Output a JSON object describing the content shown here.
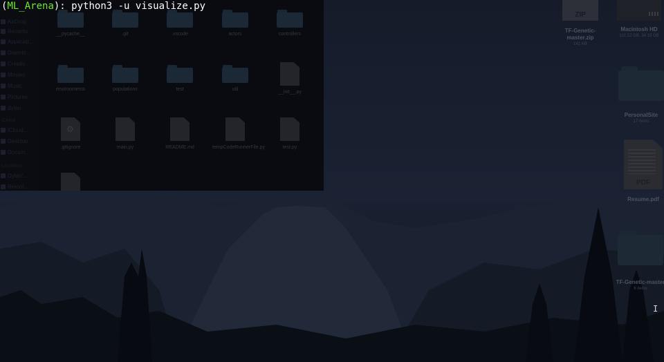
{
  "terminal": {
    "prompt_open": "(",
    "env_name": "ML_Arena",
    "prompt_close": "): ",
    "command": "python3 -u visualize.py"
  },
  "finder": {
    "sidebar": {
      "sections": [
        {
          "heading": "",
          "items": [
            "AirDrop",
            "Recents",
            "Applicati...",
            "Downlo...",
            "Creativ...",
            "Movies",
            "Music",
            "Pictures",
            "dylan"
          ]
        },
        {
          "heading": "iCloud",
          "items": [
            "iCloud...",
            "Desktop",
            "Docum..."
          ]
        },
        {
          "heading": "Locations",
          "items": [
            "Dylan'...",
            "Remot..."
          ]
        }
      ]
    },
    "items": [
      {
        "label": "__pycache__",
        "kind": "folder"
      },
      {
        "label": ".git",
        "kind": "folder"
      },
      {
        "label": ".vscode",
        "kind": "folder"
      },
      {
        "label": "actors",
        "kind": "folder"
      },
      {
        "label": "controllers",
        "kind": "folder"
      },
      {
        "label": "environments",
        "kind": "folder"
      },
      {
        "label": "populations",
        "kind": "folder"
      },
      {
        "label": "test",
        "kind": "folder"
      },
      {
        "label": "util",
        "kind": "folder"
      },
      {
        "label": "__init__.py",
        "kind": "doc"
      },
      {
        "label": ".gitignore",
        "kind": "gear"
      },
      {
        "label": "main.py",
        "kind": "doc"
      },
      {
        "label": "README.md",
        "kind": "doc"
      },
      {
        "label": "tempCodeRunnerFile.py",
        "kind": "doc"
      },
      {
        "label": "test.py",
        "kind": "doc"
      },
      {
        "label": "",
        "kind": "doc"
      }
    ]
  },
  "desktop": {
    "zip": {
      "badge": "ZIP",
      "label": "TF-Genetic-master.zip",
      "sub": "141 KB"
    },
    "hd": {
      "label": "Macintosh HD",
      "sub": "121.52 GB, 34.19 GB"
    },
    "folder1": {
      "label": "PersonalSite",
      "sub": "17 items"
    },
    "pdf": {
      "badge": "PDF",
      "label": "Resume.pdf"
    },
    "folder2": {
      "label": "TF-Genetic-master",
      "sub": "6 items"
    }
  },
  "cursor_icon": "ibeam-cursor-icon"
}
